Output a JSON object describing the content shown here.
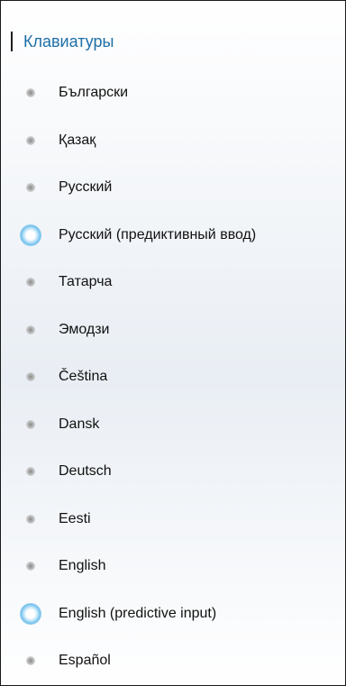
{
  "header": {
    "title": "Клавиатуры"
  },
  "keyboards": [
    {
      "label": "Български",
      "active": false
    },
    {
      "label": "Қазақ",
      "active": false
    },
    {
      "label": "Русский",
      "active": false
    },
    {
      "label": "Русский (предиктивный ввод)",
      "active": true
    },
    {
      "label": "Татарча",
      "active": false
    },
    {
      "label": "Эмодзи",
      "active": false
    },
    {
      "label": "Čeština",
      "active": false
    },
    {
      "label": "Dansk",
      "active": false
    },
    {
      "label": "Deutsch",
      "active": false
    },
    {
      "label": "Eesti",
      "active": false
    },
    {
      "label": "English",
      "active": false
    },
    {
      "label": "English (predictive input)",
      "active": true
    },
    {
      "label": "Español",
      "active": false
    }
  ],
  "colors": {
    "header_title": "#1d6fa8",
    "active_dot": "#74c1ec",
    "inactive_dot": "#b9b9b9"
  }
}
